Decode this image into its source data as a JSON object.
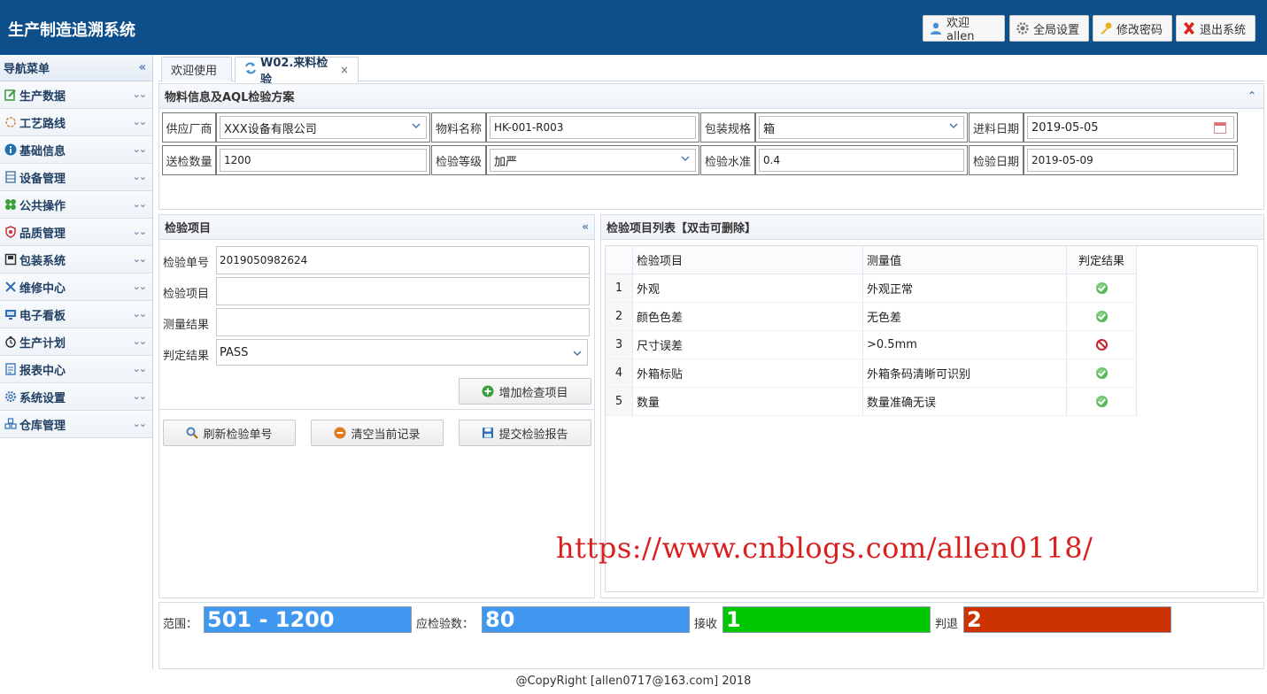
{
  "app": {
    "title": "生产制造追溯系统"
  },
  "header": {
    "welcome_label": "欢迎 allen",
    "settings_label": "全局设置",
    "password_label": "修改密码",
    "logout_label": "退出系统"
  },
  "sidebar": {
    "title": "导航菜单",
    "items": [
      {
        "label": "生产数据",
        "icon": "edit-icon"
      },
      {
        "label": "工艺路线",
        "icon": "route-icon"
      },
      {
        "label": "基础信息",
        "icon": "info-icon"
      },
      {
        "label": "设备管理",
        "icon": "device-icon"
      },
      {
        "label": "公共操作",
        "icon": "grid-icon"
      },
      {
        "label": "品质管理",
        "icon": "shield-icon"
      },
      {
        "label": "包装系统",
        "icon": "package-icon"
      },
      {
        "label": "维修中心",
        "icon": "tools-icon"
      },
      {
        "label": "电子看板",
        "icon": "monitor-icon"
      },
      {
        "label": "生产计划",
        "icon": "clock-icon"
      },
      {
        "label": "报表中心",
        "icon": "report-icon"
      },
      {
        "label": "系统设置",
        "icon": "gear-icon"
      },
      {
        "label": "仓库管理",
        "icon": "warehouse-icon"
      }
    ]
  },
  "tabs": [
    {
      "label": "欢迎使用"
    },
    {
      "label": "W02.来料检验",
      "close": "×"
    }
  ],
  "material": {
    "title": "物料信息及AQL检验方案",
    "supplier_label": "供应厂商",
    "supplier_value": "XXX设备有限公司",
    "material_label": "物料名称",
    "material_value": "HK-001-R003",
    "package_label": "包装规格",
    "package_value": "箱",
    "incoming_date_label": "进料日期",
    "incoming_date_value": "2019-05-05",
    "qty_label": "送检数量",
    "qty_value": "1200",
    "level_label": "检验等级",
    "level_value": "加严",
    "aql_label": "检验水准",
    "aql_value": "0.4",
    "inspect_date_label": "检验日期",
    "inspect_date_value": "2019-05-09"
  },
  "item_panel": {
    "title": "检验项目",
    "order_label": "检验单号",
    "order_value": "2019050982624",
    "item_label": "检验项目",
    "item_value": "",
    "measure_label": "测量结果",
    "measure_value": "",
    "judge_label": "判定结果",
    "judge_value": "PASS",
    "add_button": "增加检查项目",
    "refresh_button": "刷新检验单号",
    "clear_button": "清空当前记录",
    "submit_button": "提交检验报告"
  },
  "list_panel": {
    "title": "检验项目列表【双击可删除】",
    "columns": [
      "检验项目",
      "测量值",
      "判定结果"
    ],
    "rows": [
      {
        "num": "1",
        "item": "外观",
        "value": "外观正常",
        "result": "pass"
      },
      {
        "num": "2",
        "item": "颜色色差",
        "value": "无色差",
        "result": "pass"
      },
      {
        "num": "3",
        "item": "尺寸误差",
        "value": ">0.5mm",
        "result": "fail"
      },
      {
        "num": "4",
        "item": "外箱标贴",
        "value": "外箱条码清晰可识别",
        "result": "pass"
      },
      {
        "num": "5",
        "item": "数量",
        "value": "数量准确无误",
        "result": "pass"
      }
    ]
  },
  "watermark": "https://www.cnblogs.com/allen0118/",
  "stats": {
    "range_label": "范围：",
    "range_value": "501 - 1200",
    "sample_label": "应检验数：",
    "sample_value": "80",
    "accept_label": "接收",
    "accept_value": "1",
    "reject_label": "判退",
    "reject_value": "2",
    "colors": {
      "blue": "#3f97f0",
      "green": "#00c800",
      "red": "#cc3300"
    }
  },
  "footer": "@CopyRight [allen0717@163.com] 2018"
}
